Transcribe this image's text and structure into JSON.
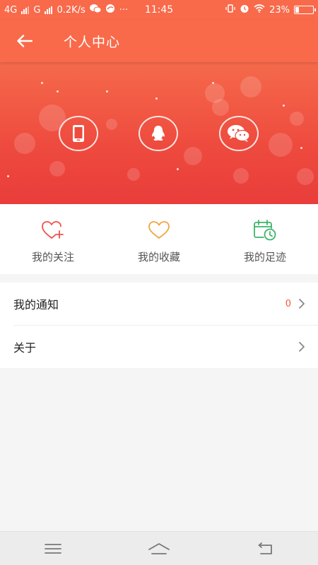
{
  "status_bar": {
    "network_1": "4G",
    "network_2": "G",
    "speed": "0.2K/s",
    "dots": "···",
    "time": "11:45",
    "battery_percent": "23%",
    "battery_level": 0.23,
    "icons": [
      "signal-icon",
      "wechat-icon",
      "browser-icon",
      "vibrate-icon",
      "alarm-icon",
      "wifi-icon",
      "battery-icon"
    ]
  },
  "app_bar": {
    "title": "个人中心",
    "back_icon": "arrow-left-icon"
  },
  "banner": {
    "login_options": [
      {
        "icon": "phone-icon"
      },
      {
        "icon": "qq-icon"
      },
      {
        "icon": "wechat-icon"
      }
    ]
  },
  "quick_actions": [
    {
      "label": "我的关注",
      "icon": "heart-plus-icon",
      "color": "#f0504b"
    },
    {
      "label": "我的收藏",
      "icon": "heart-icon",
      "color": "#f0a33a"
    },
    {
      "label": "我的足迹",
      "icon": "calendar-clock-icon",
      "color": "#3db56a"
    }
  ],
  "list": {
    "notifications": {
      "label": "我的通知",
      "count": "0"
    },
    "about": {
      "label": "关于"
    }
  },
  "nav_bar": {
    "icons": [
      "menu-icon",
      "home-icon",
      "back-icon"
    ]
  },
  "colors": {
    "accent": "#f86a4a",
    "banner_bottom": "#e93d3b",
    "badge": "#f3573d"
  }
}
